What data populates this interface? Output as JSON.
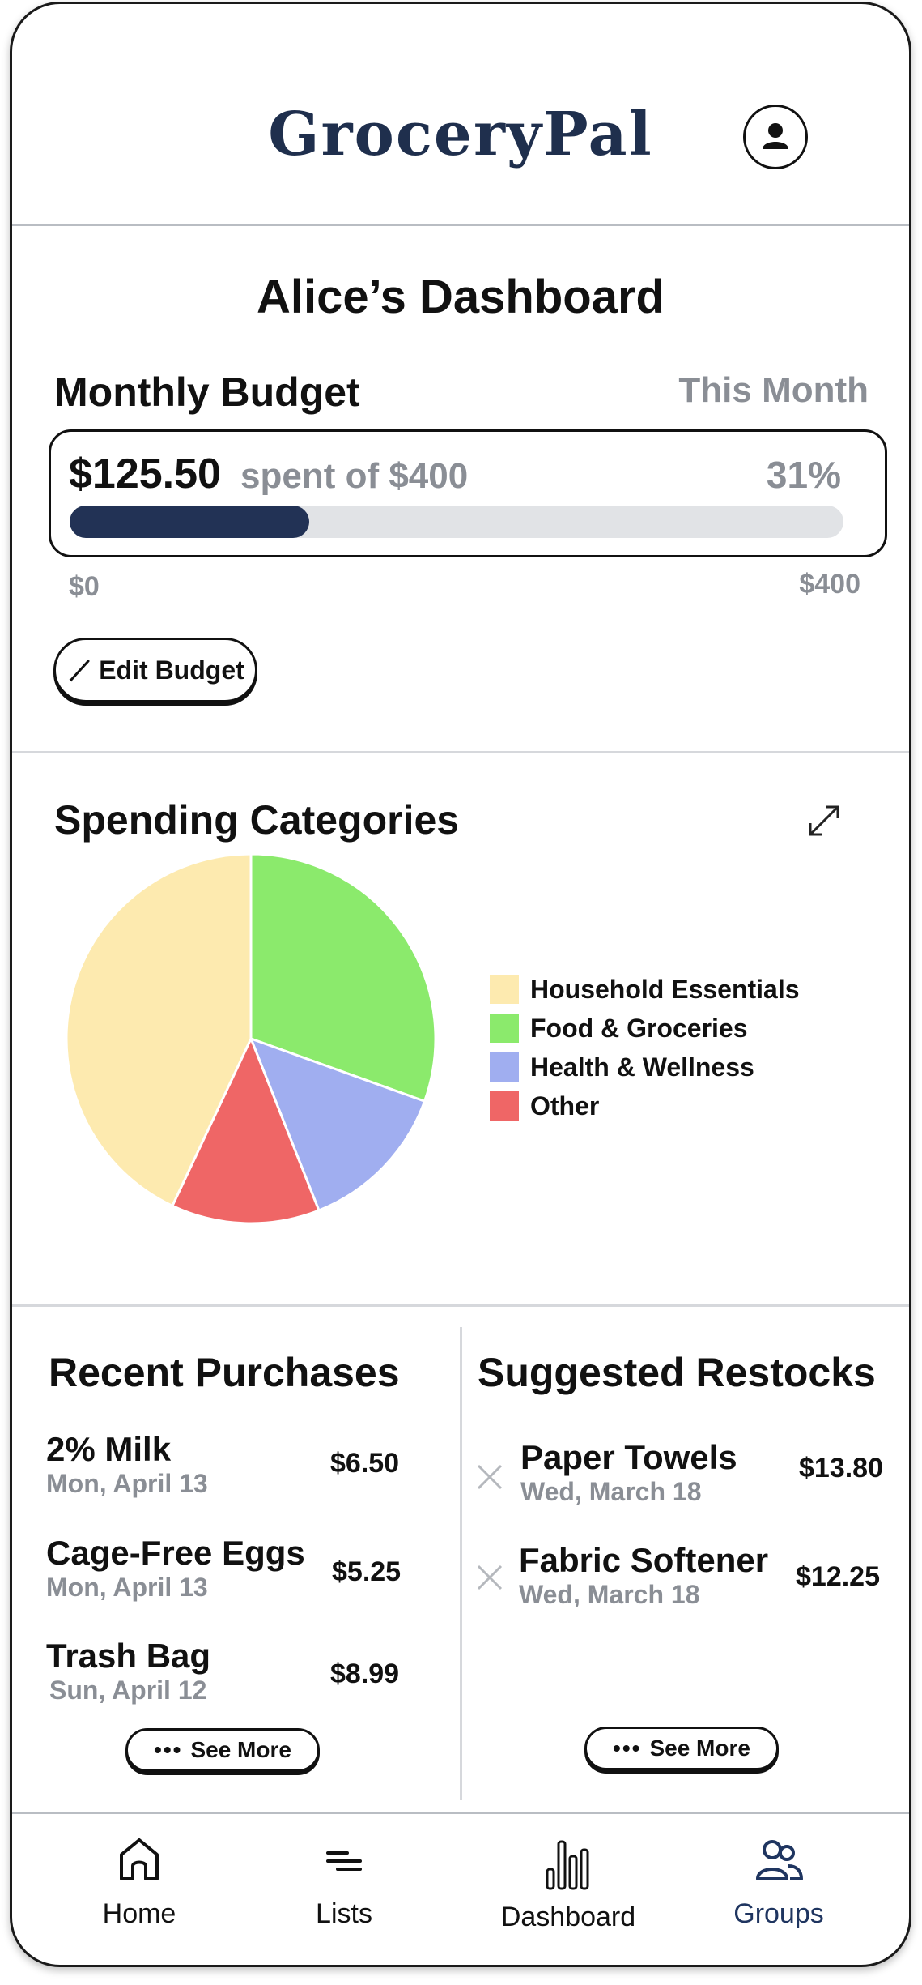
{
  "app": {
    "name": "GroceryPal"
  },
  "dashboard": {
    "title": "Alice’s Dashboard"
  },
  "budget": {
    "title": "Monthly Budget",
    "period": "This Month",
    "spent": "$125.50",
    "spent_of": "spent of $400",
    "percent_label": "31%",
    "progress": 0.31,
    "min_label": "$0",
    "max_label": "$400",
    "edit_label": "Edit Budget"
  },
  "spending": {
    "title": "Spending Categories",
    "chart_data": {
      "type": "pie",
      "slices": [
        {
          "label": "Food & Groceries",
          "value": 30.5,
          "color": "#8bea6c"
        },
        {
          "label": "Health & Wellness",
          "value": 13.5,
          "color": "#a0aef0"
        },
        {
          "label": "Other",
          "value": 13.0,
          "color": "#ef6666"
        },
        {
          "label": "Household Essentials",
          "value": 43.0,
          "color": "#fdeaaf"
        }
      ],
      "legend": [
        {
          "label": "Household Essentials",
          "color": "#fdeaaf"
        },
        {
          "label": "Food & Groceries",
          "color": "#8bea6c"
        },
        {
          "label": "Health & Wellness",
          "color": "#a0aef0"
        },
        {
          "label": "Other",
          "color": "#ef6666"
        }
      ],
      "legend_position": "right"
    }
  },
  "recent": {
    "title": "Recent Purchases",
    "items": [
      {
        "name": "2% Milk",
        "date": "Mon, April 13",
        "price": "$6.50"
      },
      {
        "name": "Cage-Free Eggs",
        "date": "Mon, April 13",
        "price": "$5.25"
      },
      {
        "name": "Trash Bag",
        "date": "Sun, April 12",
        "price": "$8.99"
      }
    ],
    "see_more": "See More"
  },
  "restocks": {
    "title": "Suggested Restocks",
    "items": [
      {
        "name": "Paper Towels",
        "date": "Wed, March 18",
        "price": "$13.80"
      },
      {
        "name": "Fabric Softener",
        "date": "Wed, March 18",
        "price": "$12.25"
      }
    ],
    "see_more": "See More"
  },
  "nav": {
    "items": [
      {
        "label": "Home"
      },
      {
        "label": "Lists"
      },
      {
        "label": "Dashboard"
      },
      {
        "label": "Groups"
      }
    ],
    "active_color": "#1f3560"
  }
}
